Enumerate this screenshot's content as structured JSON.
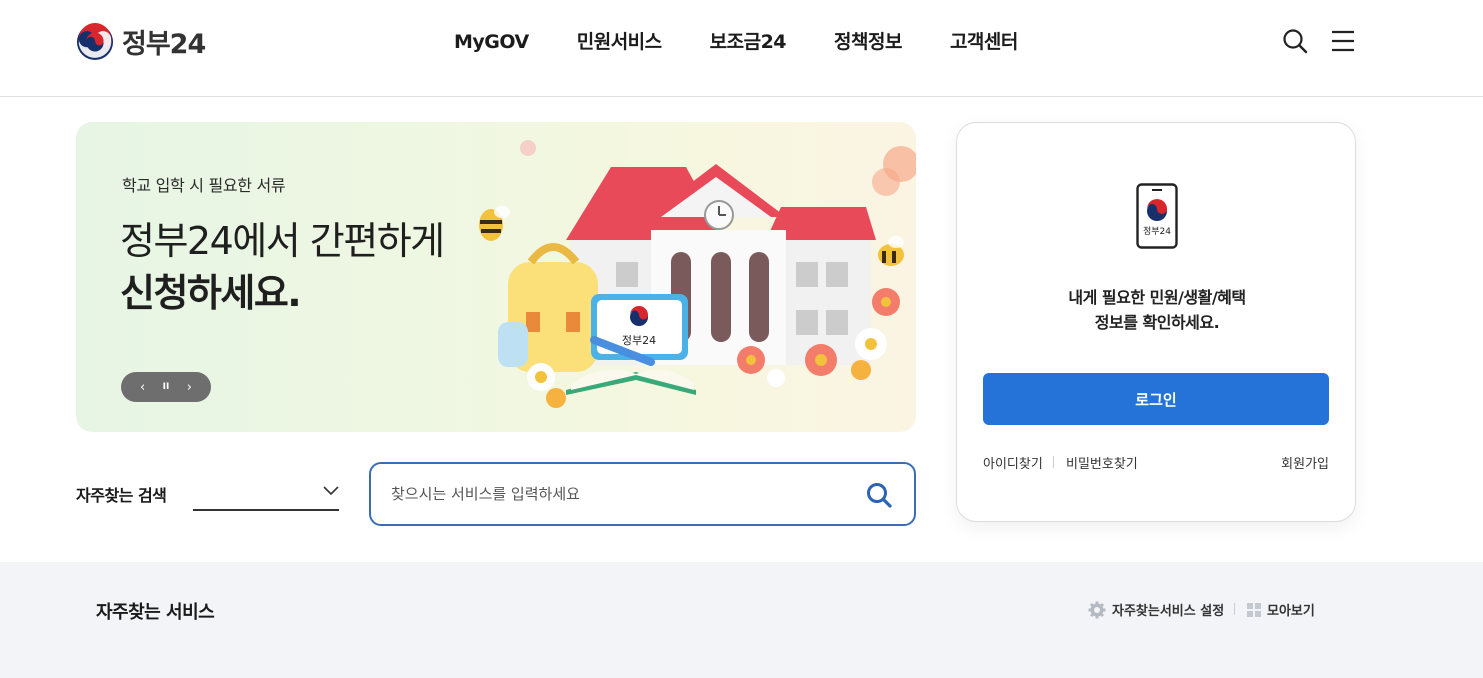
{
  "header": {
    "logo_text": "정부24",
    "nav": [
      "MyGOV",
      "민원서비스",
      "보조금24",
      "정책정보",
      "고객센터"
    ]
  },
  "banner": {
    "subtitle": "학교 입학 시 필요한 서류",
    "headline_line1": "정부24에서 간편하게",
    "headline_line2": "신청하세요.",
    "controls": {
      "prev": "‹",
      "pause": "II",
      "next": "›"
    },
    "art_sign_text": "정부24"
  },
  "frequent_search": {
    "label": "자주찾는 검색",
    "selected": ""
  },
  "search": {
    "placeholder": "찾으시는 서비스를 입력하세요",
    "value": ""
  },
  "login": {
    "phone_label": "정부24",
    "message_line1": "내게 필요한 민원/생활/혜택",
    "message_line2": "정보를 확인하세요.",
    "button": "로그인",
    "find_id": "아이디찾기",
    "find_password": "비밀번호찾기",
    "join": "회원가입"
  },
  "services": {
    "title": "자주찾는 서비스",
    "settings": "자주찾는서비스 설정",
    "view_all": "모아보기"
  },
  "colors": {
    "primary_blue": "#2572d9",
    "search_border": "#3a6db5",
    "section_bg": "#f2f4f7"
  }
}
